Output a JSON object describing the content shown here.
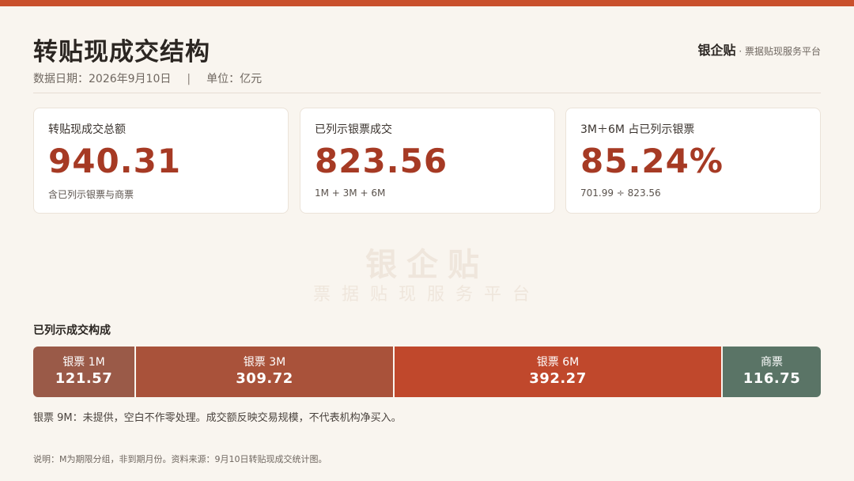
{
  "header": {
    "title": "转贴现成交结构",
    "date_text": "数据日期：2026年9月10日",
    "separator": "|",
    "unit_text": "单位：亿元",
    "brand_name": "银企贴",
    "brand_tagline": " · 票据贴现服务平台"
  },
  "cards": [
    {
      "label": "转贴现成交总额",
      "value": "940.31",
      "note": "含已列示银票与商票"
    },
    {
      "label": "已列示银票成交",
      "value": "823.56",
      "note": "1M + 3M + 6M"
    },
    {
      "label": "3M＋6M 占已列示银票",
      "value": "85.24%",
      "note": "701.99 ÷ 823.56"
    }
  ],
  "watermark": {
    "main": "银企贴",
    "sub": "票据贴现服务平台"
  },
  "composition": {
    "title": "已列示成交构成",
    "segments": [
      {
        "label": "银票 1M",
        "value": "121.57"
      },
      {
        "label": "银票 3M",
        "value": "309.72"
      },
      {
        "label": "银票 6M",
        "value": "392.27"
      },
      {
        "label": "商票",
        "value": "116.75"
      }
    ],
    "note": "银票 9M：未提供，空白不作零处理。成交额反映交易规模，不代表机构净买入。"
  },
  "footnote": "说明：M为期限分组，非到期月份。资料来源：9月10日转贴现成交统计图。",
  "colors": {
    "accent": "#c9502c",
    "value_red": "#a63a24",
    "seg_1m": "#9a5a48",
    "seg_3m": "#a9523a",
    "seg_6m": "#c0482c",
    "seg_commercial": "#5a7466"
  }
}
